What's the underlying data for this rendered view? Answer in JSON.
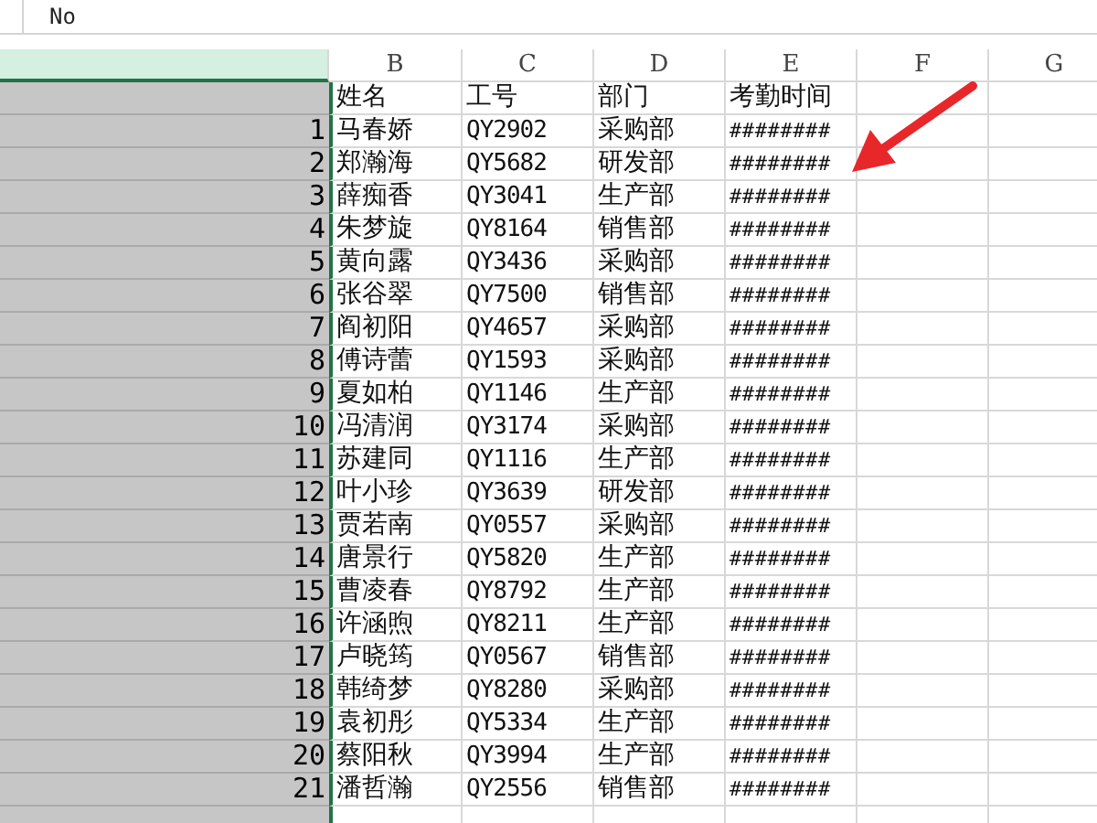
{
  "formula_bar": {
    "value": "No"
  },
  "column_a": {
    "selected": true
  },
  "column_headers": [
    "B",
    "C",
    "D",
    "E",
    "F",
    "G"
  ],
  "header_row": {
    "name": "姓名",
    "id": "工号",
    "dept": "部门",
    "time": "考勤时间"
  },
  "rows": [
    {
      "no": "1",
      "name": "马春娇",
      "id": "QY2902",
      "dept": "采购部",
      "time": "########"
    },
    {
      "no": "2",
      "name": "郑瀚海",
      "id": "QY5682",
      "dept": "研发部",
      "time": "########"
    },
    {
      "no": "3",
      "name": "薛痴香",
      "id": "QY3041",
      "dept": "生产部",
      "time": "########"
    },
    {
      "no": "4",
      "name": "朱梦旋",
      "id": "QY8164",
      "dept": "销售部",
      "time": "########"
    },
    {
      "no": "5",
      "name": "黄向露",
      "id": "QY3436",
      "dept": "采购部",
      "time": "########"
    },
    {
      "no": "6",
      "name": "张谷翠",
      "id": "QY7500",
      "dept": "销售部",
      "time": "########"
    },
    {
      "no": "7",
      "name": "阎初阳",
      "id": "QY4657",
      "dept": "采购部",
      "time": "########"
    },
    {
      "no": "8",
      "name": "傅诗蕾",
      "id": "QY1593",
      "dept": "采购部",
      "time": "########"
    },
    {
      "no": "9",
      "name": "夏如柏",
      "id": "QY1146",
      "dept": "生产部",
      "time": "########"
    },
    {
      "no": "10",
      "name": "冯清润",
      "id": "QY3174",
      "dept": "采购部",
      "time": "########"
    },
    {
      "no": "11",
      "name": "苏建同",
      "id": "QY1116",
      "dept": "生产部",
      "time": "########"
    },
    {
      "no": "12",
      "name": "叶小珍",
      "id": "QY3639",
      "dept": "研发部",
      "time": "########"
    },
    {
      "no": "13",
      "name": "贾若南",
      "id": "QY0557",
      "dept": "采购部",
      "time": "########"
    },
    {
      "no": "14",
      "name": "唐景行",
      "id": "QY5820",
      "dept": "生产部",
      "time": "########"
    },
    {
      "no": "15",
      "name": "曹凌春",
      "id": "QY8792",
      "dept": "生产部",
      "time": "########"
    },
    {
      "no": "16",
      "name": "许涵煦",
      "id": "QY8211",
      "dept": "生产部",
      "time": "########"
    },
    {
      "no": "17",
      "name": "卢晓筠",
      "id": "QY0567",
      "dept": "销售部",
      "time": "########"
    },
    {
      "no": "18",
      "name": "韩绮梦",
      "id": "QY8280",
      "dept": "采购部",
      "time": "########"
    },
    {
      "no": "19",
      "name": "袁初彤",
      "id": "QY5334",
      "dept": "生产部",
      "time": "########"
    },
    {
      "no": "20",
      "name": "蔡阳秋",
      "id": "QY3994",
      "dept": "生产部",
      "time": "########"
    },
    {
      "no": "21",
      "name": "潘哲瀚",
      "id": "QY2556",
      "dept": "销售部",
      "time": "########"
    }
  ]
}
